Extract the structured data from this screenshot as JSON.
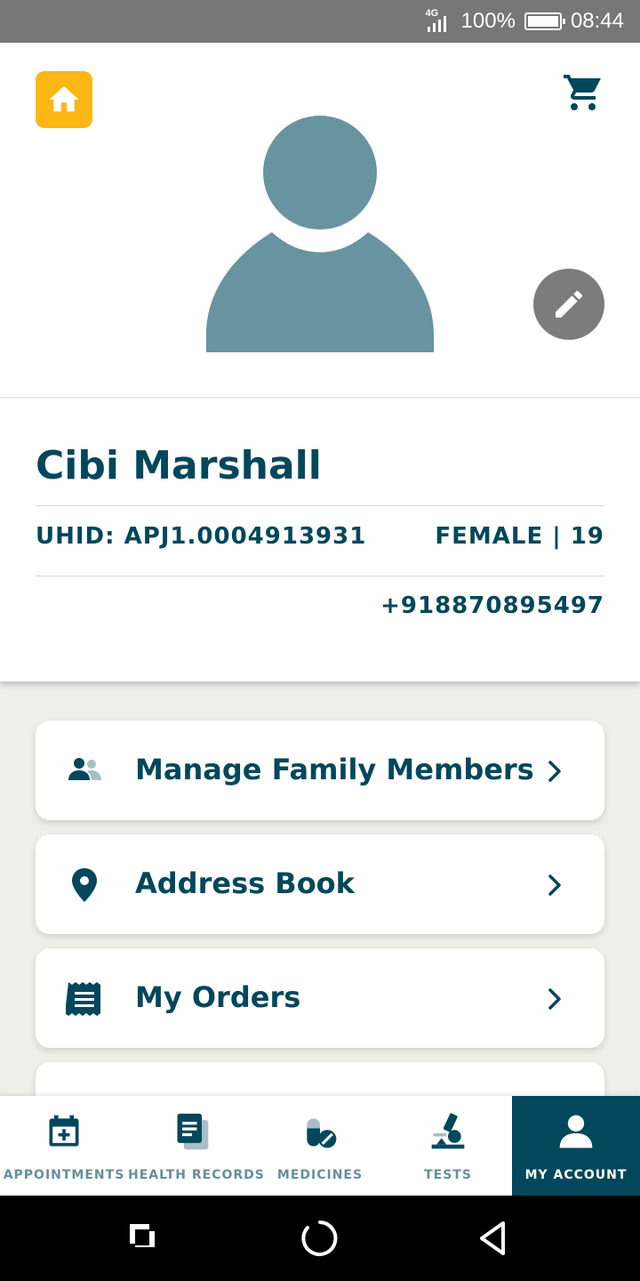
{
  "status_bar": {
    "network": "4G",
    "battery_percent": "100%",
    "time": "08:44"
  },
  "header": {
    "home_icon": "home-icon",
    "cart_icon": "cart-icon",
    "avatar_icon": "person-placeholder-icon",
    "edit_icon": "pencil-icon",
    "accent_color": "#fcb716"
  },
  "profile": {
    "name": "Cibi Marshall",
    "uhid": "UHID: APJ1.0004913931",
    "gender_age": "FEMALE | 19",
    "phone": "+918870895497"
  },
  "menu": {
    "items": [
      {
        "label": "Manage Family Members",
        "icon": "family-members-icon"
      },
      {
        "label": "Address Book",
        "icon": "location-pin-icon"
      },
      {
        "label": "My Orders",
        "icon": "receipt-icon"
      }
    ]
  },
  "tabbar": {
    "tabs": [
      {
        "label": "APPOINTMENTS",
        "icon": "calendar-plus-icon"
      },
      {
        "label": "HEALTH RECORDS",
        "icon": "records-icon"
      },
      {
        "label": "MEDICINES",
        "icon": "pill-icon"
      },
      {
        "label": "TESTS",
        "icon": "microscope-icon"
      },
      {
        "label": "MY ACCOUNT",
        "icon": "account-icon"
      }
    ],
    "active": "MY ACCOUNT",
    "brand_color": "#02475b"
  }
}
